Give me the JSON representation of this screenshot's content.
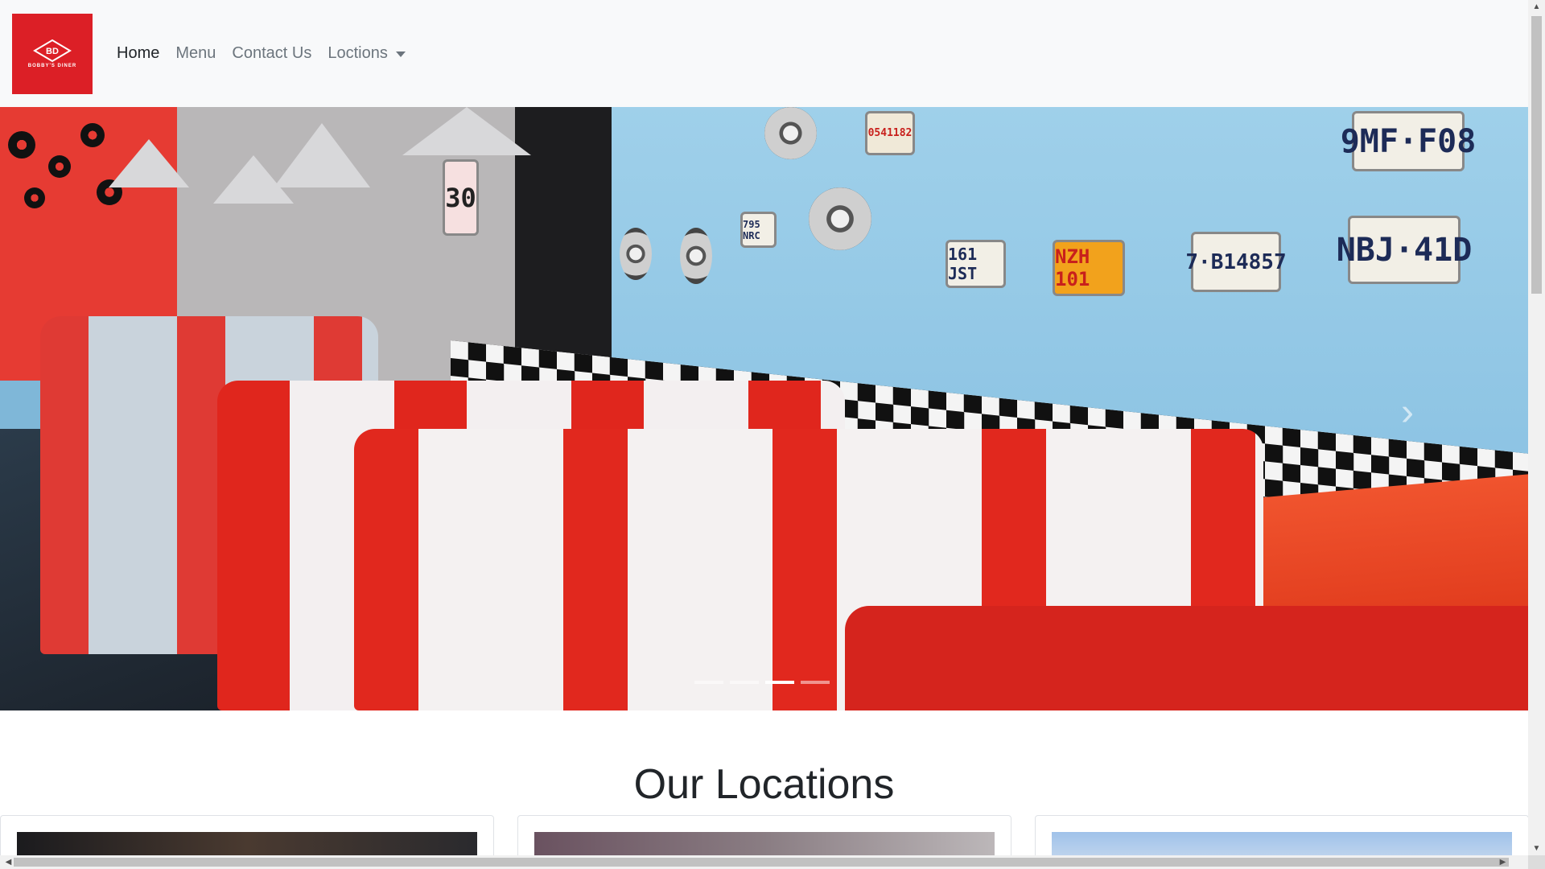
{
  "brand": {
    "monogram": "BD",
    "name": "BOBBY'S DINER",
    "color": "#dc1f26"
  },
  "nav": {
    "items": [
      {
        "label": "Home",
        "active": true
      },
      {
        "label": "Menu",
        "active": false
      },
      {
        "label": "Contact Us",
        "active": false
      },
      {
        "label": "Loctions",
        "active": false,
        "dropdown": true
      }
    ]
  },
  "carousel": {
    "slide_count": 4,
    "active_slide": 3,
    "next_icon": "chevron-right-icon",
    "plates": [
      "9MF·F08",
      "NBJ·41D",
      "7·B14857",
      "NZH 101",
      "161 JST",
      "795 NRC",
      "0541182",
      "30"
    ]
  },
  "locations": {
    "title": "Our Locations",
    "card_count": 3
  },
  "scrollbars": {
    "vertical": true,
    "horizontal": true
  }
}
